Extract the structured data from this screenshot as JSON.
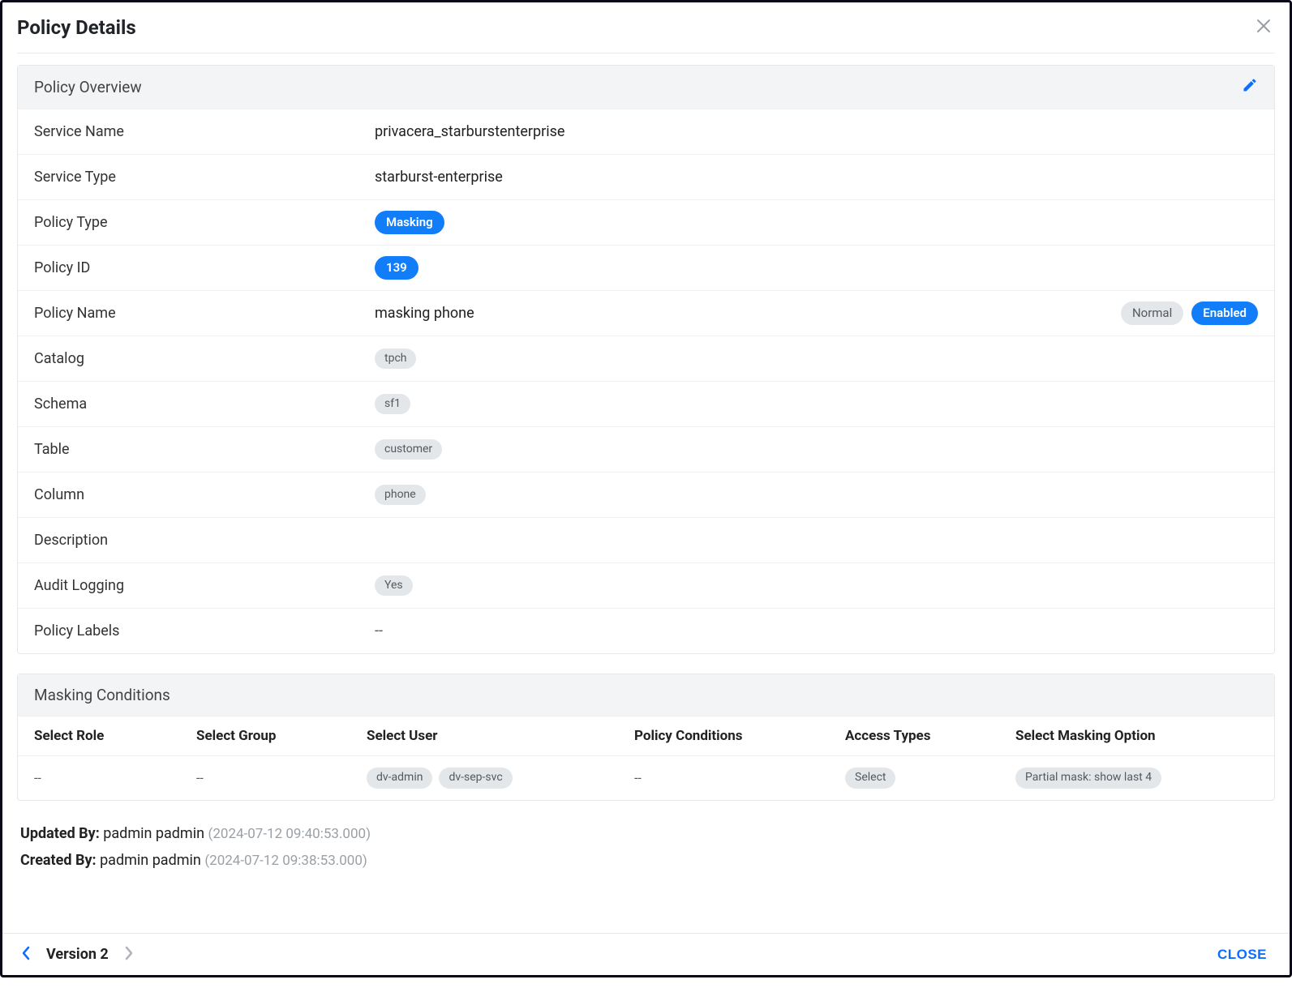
{
  "dialog": {
    "title": "Policy Details",
    "close_btn": "CLOSE",
    "version_label": "Version 2"
  },
  "overview": {
    "header": "Policy Overview",
    "rows": {
      "service_name": {
        "label": "Service Name",
        "value": "privacera_starburstenterprise"
      },
      "service_type": {
        "label": "Service Type",
        "value": "starburst-enterprise"
      },
      "policy_type": {
        "label": "Policy Type",
        "pill_blue": "Masking"
      },
      "policy_id": {
        "label": "Policy ID",
        "pill_blue": "139"
      },
      "policy_name": {
        "label": "Policy Name",
        "value": "masking phone",
        "badge_normal": "Normal",
        "badge_enabled": "Enabled"
      },
      "catalog": {
        "label": "Catalog",
        "pill_grey": "tpch"
      },
      "schema": {
        "label": "Schema",
        "pill_grey": "sf1"
      },
      "table": {
        "label": "Table",
        "pill_grey": "customer"
      },
      "column": {
        "label": "Column",
        "pill_grey": "phone"
      },
      "description": {
        "label": "Description",
        "value": ""
      },
      "audit_logging": {
        "label": "Audit Logging",
        "pill_grey": "Yes"
      },
      "policy_labels": {
        "label": "Policy Labels",
        "value": "--"
      }
    }
  },
  "conditions": {
    "header": "Masking Conditions",
    "columns": {
      "role": "Select Role",
      "group": "Select Group",
      "user": "Select User",
      "pc": "Policy Conditions",
      "at": "Access Types",
      "mopt": "Select Masking Option"
    },
    "rows": [
      {
        "role": "--",
        "group": "--",
        "users": [
          "dv-admin",
          "dv-sep-svc"
        ],
        "pc": "--",
        "at": "Select",
        "mopt": "Partial mask: show last 4"
      }
    ]
  },
  "meta": {
    "updated_by_label": "Updated By:",
    "updated_by_user": "padmin padmin",
    "updated_by_ts": "(2024-07-12 09:40:53.000)",
    "created_by_label": "Created By:",
    "created_by_user": "padmin padmin",
    "created_by_ts": "(2024-07-12 09:38:53.000)"
  }
}
